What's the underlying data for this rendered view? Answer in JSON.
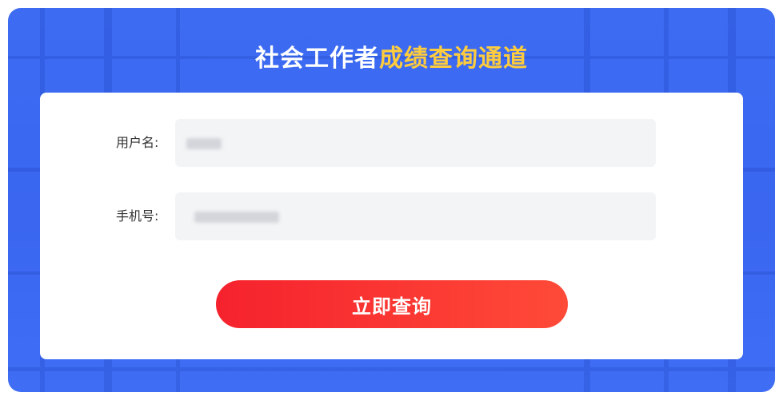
{
  "header": {
    "title_part1": "社会工作者",
    "title_part2": "成绩查询通道"
  },
  "form": {
    "username_label": "用户名:",
    "phone_label": "手机号:",
    "submit_label": "立即查询"
  },
  "colors": {
    "banner_blue": "#3d6cf2",
    "title_highlight": "#ffcc3d",
    "button_red": "#f5222d",
    "field_bg": "#f3f4f6"
  }
}
